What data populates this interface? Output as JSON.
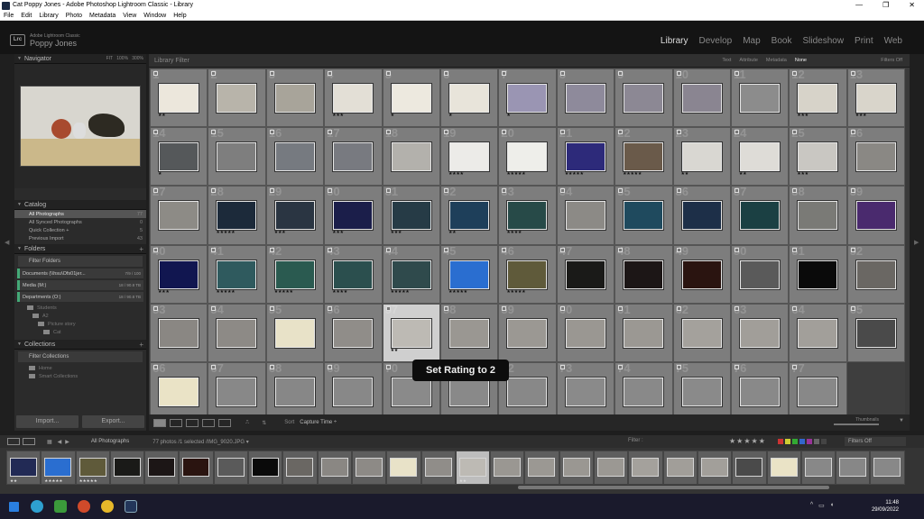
{
  "window": {
    "title": "Cat Poppy Jones - Adobe Photoshop Lightroom Classic - Library"
  },
  "menu": [
    "File",
    "Edit",
    "Library",
    "Photo",
    "Metadata",
    "View",
    "Window",
    "Help"
  ],
  "identity": {
    "product": "Adobe Lightroom Classic",
    "user": "Poppy Jones",
    "logo": "Lrc"
  },
  "modules": [
    {
      "label": "Library",
      "active": true
    },
    {
      "label": "Develop",
      "active": false
    },
    {
      "label": "Map",
      "active": false
    },
    {
      "label": "Book",
      "active": false
    },
    {
      "label": "Slideshow",
      "active": false
    },
    {
      "label": "Print",
      "active": false
    },
    {
      "label": "Web",
      "active": false
    }
  ],
  "navigator": {
    "title": "Navigator",
    "zoom": [
      "FIT",
      "100%",
      "300%"
    ]
  },
  "catalog": {
    "title": "Catalog",
    "items": [
      {
        "label": "All Photographs",
        "count": "77",
        "selected": true
      },
      {
        "label": "All Synced Photographs",
        "count": "0"
      },
      {
        "label": "Quick Collection +",
        "count": "5"
      },
      {
        "label": "Previous Import",
        "count": "43"
      }
    ]
  },
  "folders": {
    "title": "Folders",
    "filter_label": "Filter Folders",
    "volumes": [
      {
        "label": "Documents (\\\\hsu\\Ofs01jer...",
        "meta": "7/9 / 100"
      },
      {
        "label": "Media (M:)",
        "meta": "18 / 90.8 TB"
      },
      {
        "label": "Departments (O:)",
        "meta": "18 / 90.8 TB"
      }
    ],
    "tree": [
      "Students",
      "A2",
      "Picture story",
      "Cat"
    ]
  },
  "collections": {
    "title": "Collections",
    "filter_label": "Filter Collections",
    "items": [
      "Home",
      "Smart Collections"
    ]
  },
  "left_buttons": {
    "import": "Import...",
    "export": "Export..."
  },
  "filterbar": {
    "title": "Library Filter",
    "buttons": [
      {
        "label": "Text",
        "active": false
      },
      {
        "label": "Attribute",
        "active": false
      },
      {
        "label": "Metadata",
        "active": false
      },
      {
        "label": "None",
        "active": true
      }
    ],
    "filters_off": "Filters Off"
  },
  "grid": {
    "cells": [
      {
        "n": "1",
        "c": "#ece7dc",
        "s": "★★"
      },
      {
        "n": "2",
        "c": "#b8b4aa",
        "s": ""
      },
      {
        "n": "3",
        "c": "#a8a49a",
        "s": ""
      },
      {
        "n": "4",
        "c": "#e3dfd6",
        "s": "★★★"
      },
      {
        "n": "5",
        "c": "#ede9df",
        "s": "★"
      },
      {
        "n": "6",
        "c": "#e8e4da",
        "s": "★"
      },
      {
        "n": "7",
        "c": "#9a95b3",
        "s": "★"
      },
      {
        "n": "8",
        "c": "#8e8a9b",
        "s": ""
      },
      {
        "n": "9",
        "c": "#8c8894",
        "s": ""
      },
      {
        "n": "10",
        "c": "#8a8591",
        "s": ""
      },
      {
        "n": "11",
        "c": "#8c8c8c",
        "s": ""
      },
      {
        "n": "12",
        "c": "#d7d3c9",
        "s": "★★★"
      },
      {
        "n": "13",
        "c": "#d9d5cb",
        "s": "★★★"
      },
      {
        "n": "14",
        "c": "#55585a",
        "s": "★"
      },
      {
        "n": "15",
        "c": "#7e7e7e",
        "s": ""
      },
      {
        "n": "16",
        "c": "#767a80",
        "s": ""
      },
      {
        "n": "17",
        "c": "#787a80",
        "s": ""
      },
      {
        "n": "18",
        "c": "#b3b1ac",
        "s": ""
      },
      {
        "n": "19",
        "c": "#ecebe8",
        "s": "★★★★"
      },
      {
        "n": "20",
        "c": "#eeeeea",
        "s": "★★★★★"
      },
      {
        "n": "21",
        "c": "#2d2a7a",
        "s": "★★★★★"
      },
      {
        "n": "22",
        "c": "#6a5a4a",
        "s": "★★★★★"
      },
      {
        "n": "23",
        "c": "#d9d7d2",
        "s": "★★"
      },
      {
        "n": "24",
        "c": "#dedcd7",
        "s": "★★"
      },
      {
        "n": "25",
        "c": "#c9c7c2",
        "s": "★★★"
      },
      {
        "n": "26",
        "c": "#8a8884",
        "s": ""
      },
      {
        "n": "27",
        "c": "#8d8b86",
        "s": ""
      },
      {
        "n": "28",
        "c": "#1c2a3a",
        "s": "★★★★★"
      },
      {
        "n": "29",
        "c": "#2a3542",
        "s": "★★★"
      },
      {
        "n": "30",
        "c": "#1b1e4a",
        "s": "★★★"
      },
      {
        "n": "31",
        "c": "#263b46",
        "s": "★★★"
      },
      {
        "n": "32",
        "c": "#1e3f5a",
        "s": "★★"
      },
      {
        "n": "33",
        "c": "#274a48",
        "s": "★★★★"
      },
      {
        "n": "34",
        "c": "#8c8a86",
        "s": ""
      },
      {
        "n": "35",
        "c": "#1f4a5e",
        "s": ""
      },
      {
        "n": "36",
        "c": "#1d2f48",
        "s": ""
      },
      {
        "n": "37",
        "c": "#1b4043",
        "s": ""
      },
      {
        "n": "38",
        "c": "#7a7a76",
        "s": ""
      },
      {
        "n": "39",
        "c": "#4a2a6e",
        "s": ""
      },
      {
        "n": "40",
        "c": "#111650",
        "s": "★★★"
      },
      {
        "n": "41",
        "c": "#2f5a5e",
        "s": "★★★★★"
      },
      {
        "n": "42",
        "c": "#2a5a50",
        "s": "★★★★★"
      },
      {
        "n": "43",
        "c": "#2b4f4e",
        "s": "★★★★"
      },
      {
        "n": "44",
        "c": "#2f4a4c",
        "s": "★★★★★"
      },
      {
        "n": "45",
        "c": "#2a6ed0",
        "s": "★★★★★"
      },
      {
        "n": "46",
        "c": "#5f5a3a",
        "s": "★★★★★"
      },
      {
        "n": "47",
        "c": "#1a1a18",
        "s": ""
      },
      {
        "n": "48",
        "c": "#1c1616",
        "s": ""
      },
      {
        "n": "49",
        "c": "#2a1410",
        "s": ""
      },
      {
        "n": "50",
        "c": "#5a5a5a",
        "s": ""
      },
      {
        "n": "51",
        "c": "#0a0a0a",
        "s": ""
      },
      {
        "n": "52",
        "c": "#6a6763",
        "s": ""
      },
      {
        "n": "53",
        "c": "#8a8783",
        "s": ""
      },
      {
        "n": "54",
        "c": "#8d8a86",
        "s": ""
      },
      {
        "n": "55",
        "c": "#e8e2c8",
        "s": ""
      },
      {
        "n": "56",
        "c": "#908d89",
        "s": ""
      },
      {
        "n": "57",
        "c": "#bdbab4",
        "s": "★★"
      },
      {
        "n": "58",
        "c": "#9a9792",
        "s": ""
      },
      {
        "n": "59",
        "c": "#9b9893",
        "s": ""
      },
      {
        "n": "60",
        "c": "#9a9792",
        "s": ""
      },
      {
        "n": "61",
        "c": "#9b9893",
        "s": ""
      },
      {
        "n": "62",
        "c": "#a4a19c",
        "s": ""
      },
      {
        "n": "63",
        "c": "#a19e99",
        "s": ""
      },
      {
        "n": "64",
        "c": "#a29f9a",
        "s": ""
      },
      {
        "n": "65",
        "c": "#4a4a4a",
        "s": ""
      },
      {
        "n": "66",
        "c": "#eae3c6",
        "s": ""
      },
      {
        "n": "67",
        "c": "#888",
        "s": ""
      },
      {
        "n": "68",
        "c": "#878787",
        "s": ""
      },
      {
        "n": "69",
        "c": "#888",
        "s": ""
      },
      {
        "n": "70",
        "c": "#8a8a8a",
        "s": ""
      },
      {
        "n": "71",
        "c": "#898989",
        "s": ""
      },
      {
        "n": "72",
        "c": "#888",
        "s": ""
      },
      {
        "n": "73",
        "c": "#8a8a8a",
        "s": ""
      },
      {
        "n": "74",
        "c": "#898989",
        "s": ""
      },
      {
        "n": "75",
        "c": "#8a8a8a",
        "s": ""
      },
      {
        "n": "76",
        "c": "#898989",
        "s": ""
      },
      {
        "n": "77",
        "c": "#888",
        "s": ""
      },
      {
        "n": "",
        "c": "",
        "s": ""
      }
    ]
  },
  "tooltip": "Set Rating to 2",
  "toolbar": {
    "sort_label": "Sort",
    "sort_value": "Capture Time ÷",
    "thumbnails": "Thumbnails"
  },
  "filmstrip_bar": {
    "source": "All Photographs",
    "count": "77 photos /1 selected /IMG_9020.JPG ▾",
    "filter_label": "Filter :",
    "stars": "★★★★★",
    "filters_off": "Filters Off",
    "swatch_colors": [
      "#c33",
      "#cc3",
      "#3a3",
      "#36c",
      "#939",
      "#666",
      "#444"
    ]
  },
  "filmstrip": [
    {
      "c": "#222a55",
      "s": "★★"
    },
    {
      "c": "#2a6ed0",
      "s": "★★★★★"
    },
    {
      "c": "#5f5a3a",
      "s": "★★★★★"
    },
    {
      "c": "#1a1a18",
      "s": ""
    },
    {
      "c": "#1c1616",
      "s": ""
    },
    {
      "c": "#2a1410",
      "s": ""
    },
    {
      "c": "#5a5a5a",
      "s": ""
    },
    {
      "c": "#0a0a0a",
      "s": ""
    },
    {
      "c": "#6a6763",
      "s": ""
    },
    {
      "c": "#8a8783",
      "s": ""
    },
    {
      "c": "#8d8a86",
      "s": ""
    },
    {
      "c": "#e8e2c8",
      "s": ""
    },
    {
      "c": "#908d89",
      "s": ""
    },
    {
      "c": "#bdbab4",
      "s": "★★",
      "sel": true
    },
    {
      "c": "#9a9792",
      "s": ""
    },
    {
      "c": "#9b9893",
      "s": ""
    },
    {
      "c": "#9a9792",
      "s": ""
    },
    {
      "c": "#9b9893",
      "s": ""
    },
    {
      "c": "#a4a19c",
      "s": ""
    },
    {
      "c": "#a19e99",
      "s": ""
    },
    {
      "c": "#a29f9a",
      "s": ""
    },
    {
      "c": "#4a4a4a",
      "s": ""
    },
    {
      "c": "#eae3c6",
      "s": ""
    },
    {
      "c": "#888",
      "s": ""
    },
    {
      "c": "#878787",
      "s": ""
    },
    {
      "c": "#888",
      "s": ""
    }
  ],
  "taskbar": {
    "time": "11:48",
    "date": "29/09/2022"
  }
}
